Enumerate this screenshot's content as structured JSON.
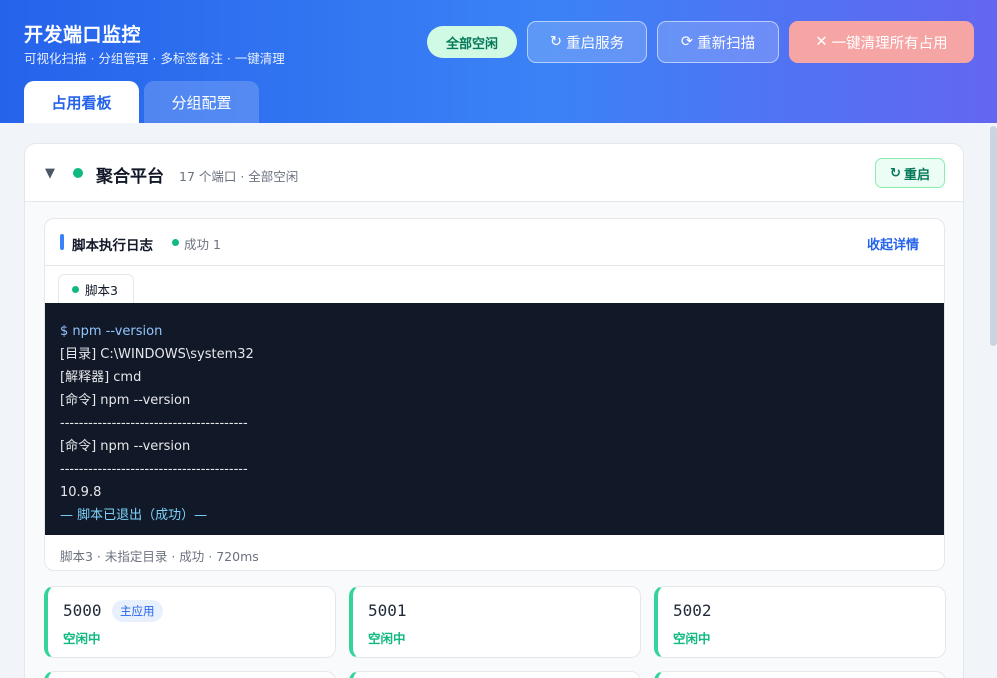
{
  "header": {
    "title": "开发端口监控",
    "subtitle": "可视化扫描 · 分组管理 · 多标签备注 · 一键清理",
    "status_pill": "全部空闲",
    "buttons": {
      "restart_service": "重启服务",
      "rescan": "重新扫描",
      "clear_all": "一键清理所有占用"
    },
    "icons": {
      "restart": "↻",
      "rescan": "⟳",
      "clear": "✕"
    },
    "tabs": [
      {
        "label": "占用看板",
        "active": true
      },
      {
        "label": "分组配置",
        "active": false
      }
    ]
  },
  "group": {
    "caret": "▼",
    "name": "聚合平台",
    "meta": "17 个端口 · 全部空闲",
    "restart_label": "重启",
    "restart_icon": "↻"
  },
  "log": {
    "title": "脚本执行日志",
    "status": "成功 1",
    "collapse_label": "收起详情",
    "script_tab": "脚本3",
    "lines": [
      "$ npm --version",
      "[目录] C:\\WINDOWS\\system32",
      "[解释器] cmd",
      "[命令] npm --version",
      "----------------------------------------",
      "[命令] npm --version",
      "----------------------------------------",
      "10.9.8",
      "— 脚本已退出（成功）—"
    ],
    "footer": "脚本3 · 未指定目录 · 成功 · 720ms"
  },
  "ports": [
    {
      "number": "5000",
      "tag": "主应用",
      "status": "空闲中"
    },
    {
      "number": "5001",
      "tag": "",
      "status": "空闲中"
    },
    {
      "number": "5002",
      "tag": "",
      "status": "空闲中"
    }
  ],
  "colors": {
    "accent": "#2563eb",
    "success": "#10b981",
    "danger_soft": "#f6a5a5",
    "terminal_bg": "#111827"
  }
}
